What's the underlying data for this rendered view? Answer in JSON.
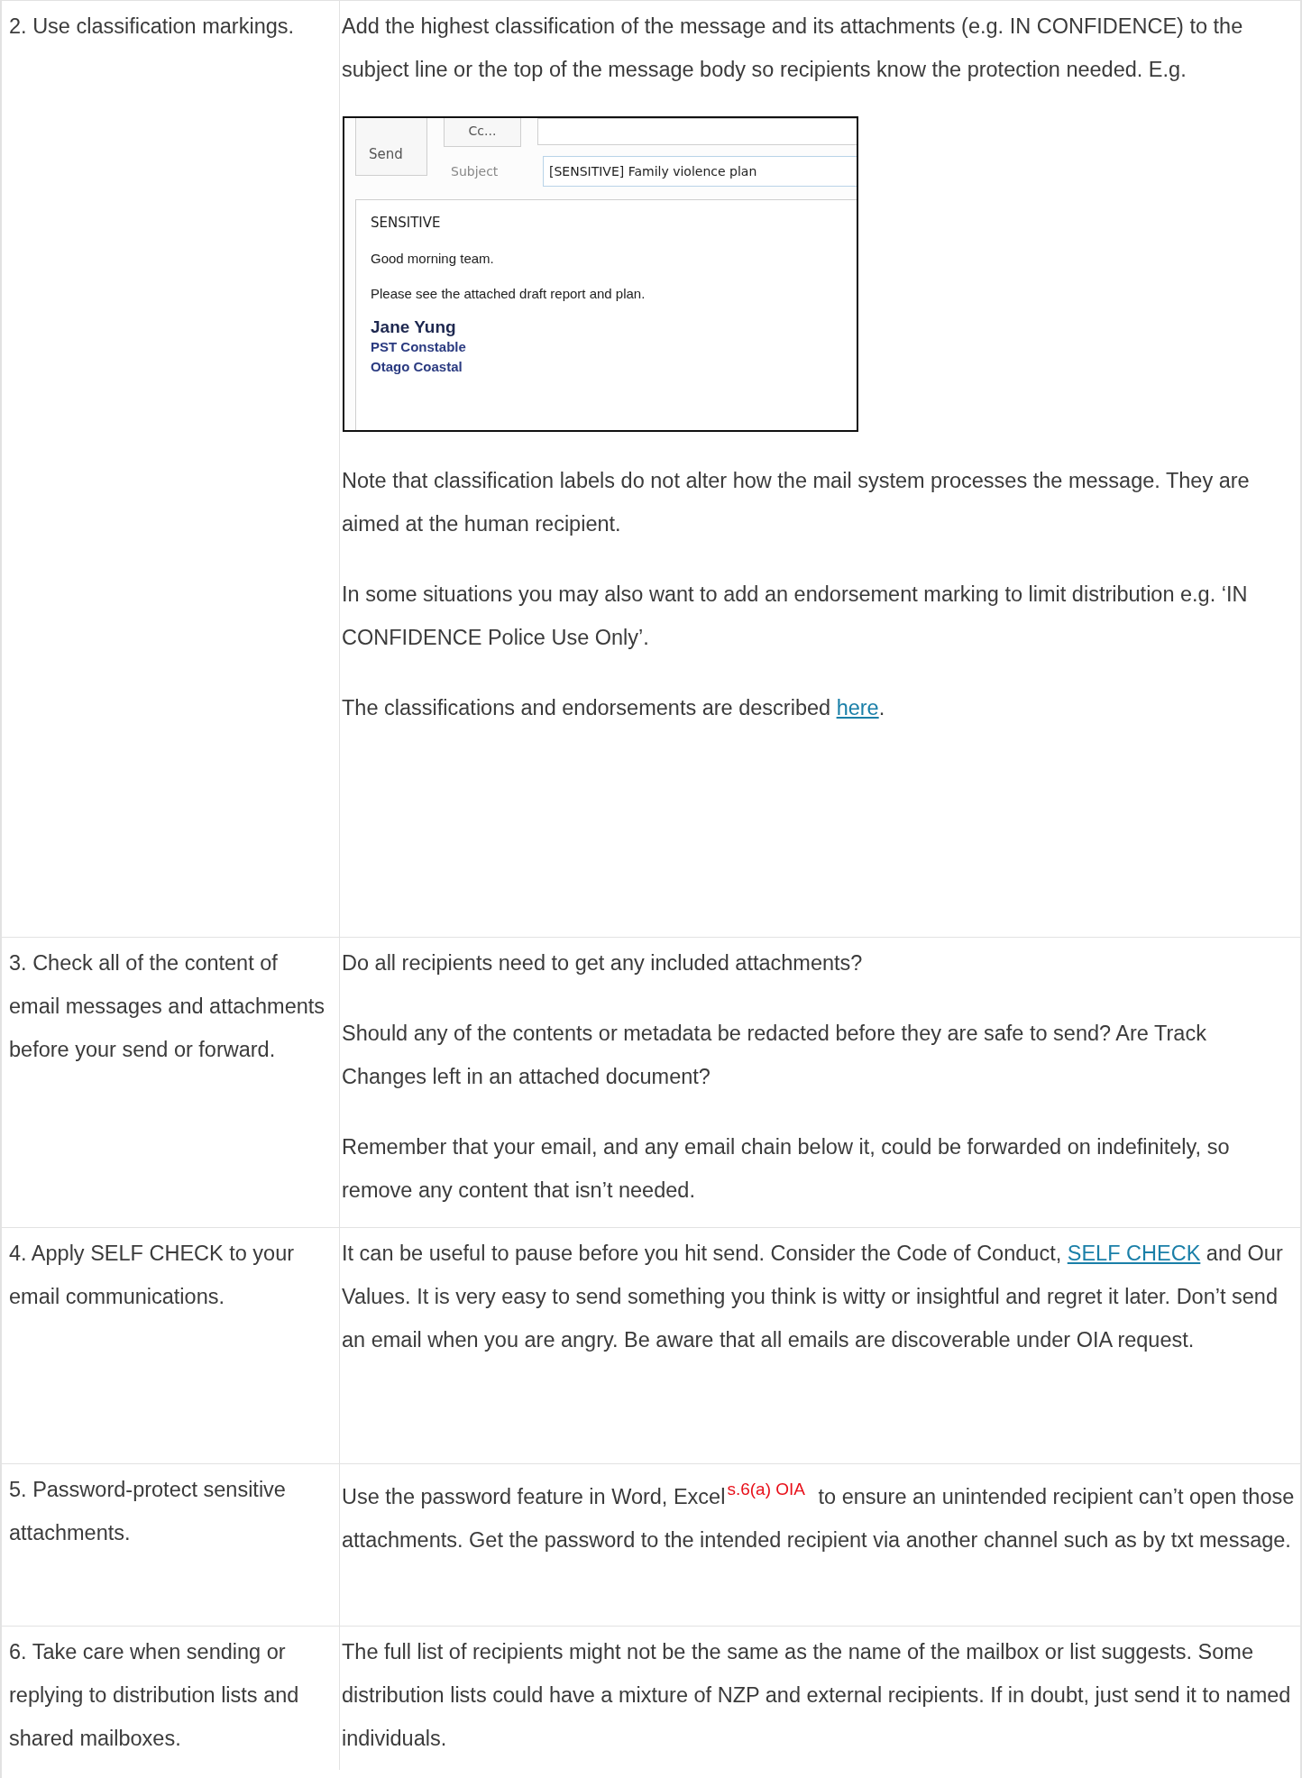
{
  "rows": [
    {
      "step": "2. Use classification markings.",
      "content": [
        {
          "kind": "paragraph",
          "segments": [
            {
              "kind": "text",
              "text": "Add the highest classification of the message and its attachments (e.g. IN CONFIDENCE) to the subject line or the top of the message body so recipients know the protection needed. E.g."
            }
          ]
        },
        {
          "kind": "email_example",
          "send": "Send",
          "cc": "Cc...",
          "subject_label": "Subject",
          "subject": "[SENSITIVE] Family violence plan",
          "body": [
            "SENSITIVE",
            "Good morning team.",
            "Please see the attached draft report and plan."
          ],
          "signature": {
            "name": "Jane Yung",
            "title": "PST Constable",
            "place": "Otago Coastal"
          }
        },
        {
          "kind": "paragraph",
          "segments": [
            {
              "kind": "text",
              "text": "Note that classification labels do not alter how the mail system processes the message. They are aimed at the human recipient."
            }
          ]
        },
        {
          "kind": "paragraph",
          "segments": [
            {
              "kind": "text",
              "text": "In some situations you may also want to add an endorsement marking to limit distribution e.g. ‘IN CONFIDENCE Police Use Only’."
            }
          ]
        },
        {
          "kind": "paragraph",
          "segments": [
            {
              "kind": "text",
              "text": "The classifications and endorsements are described "
            },
            {
              "kind": "link",
              "text": "here"
            },
            {
              "kind": "text",
              "text": "."
            }
          ]
        }
      ]
    },
    {
      "step": "3. Check all of the content of email messages and attachments before your send or forward.",
      "content": [
        {
          "kind": "paragraph",
          "segments": [
            {
              "kind": "text",
              "text": "Do all recipients need to get any included attachments?"
            }
          ]
        },
        {
          "kind": "paragraph",
          "segments": [
            {
              "kind": "text",
              "text": "Should any of the contents or metadata be redacted before they are safe to send? Are Track Changes left in an attached document?"
            }
          ]
        },
        {
          "kind": "paragraph",
          "segments": [
            {
              "kind": "text",
              "text": "Remember that your email, and any email chain below it, could be forwarded on indefinitely, so remove any content that isn’t needed."
            }
          ]
        }
      ]
    },
    {
      "step": "4. Apply SELF CHECK to your email communications.",
      "content": [
        {
          "kind": "paragraph",
          "segments": [
            {
              "kind": "text",
              "text": "It can be useful to pause before you hit send. Consider the Code of Conduct, "
            },
            {
              "kind": "link",
              "text": "SELF CHECK"
            },
            {
              "kind": "text",
              "text": " and Our Values. It is very easy to send something you think is witty or insightful and regret it later. Don’t send an email when you are angry. Be aware that all emails are discoverable under OIA request."
            }
          ]
        }
      ]
    },
    {
      "step": "5. Password-protect sensitive attachments.",
      "content": [
        {
          "kind": "paragraph",
          "segments": [
            {
              "kind": "text",
              "text": "Use the password feature in Word, Excel"
            },
            {
              "kind": "redaction",
              "text": "s.6(a) OIA"
            },
            {
              "kind": "text",
              "text": " to ensure an unintended recipient can’t open those attachments. Get the password to the intended recipient via another channel such as by txt message."
            }
          ]
        }
      ]
    },
    {
      "step": "6. Take care when sending or replying to distribution lists and shared mailboxes.",
      "content": [
        {
          "kind": "paragraph",
          "segments": [
            {
              "kind": "text",
              "text": "The full list of recipients might not be the same as the name of the mailbox or list suggests. Some distribution lists could have a mixture of NZP and external recipients. If in doubt, just send it to named individuals."
            }
          ]
        }
      ]
    }
  ]
}
